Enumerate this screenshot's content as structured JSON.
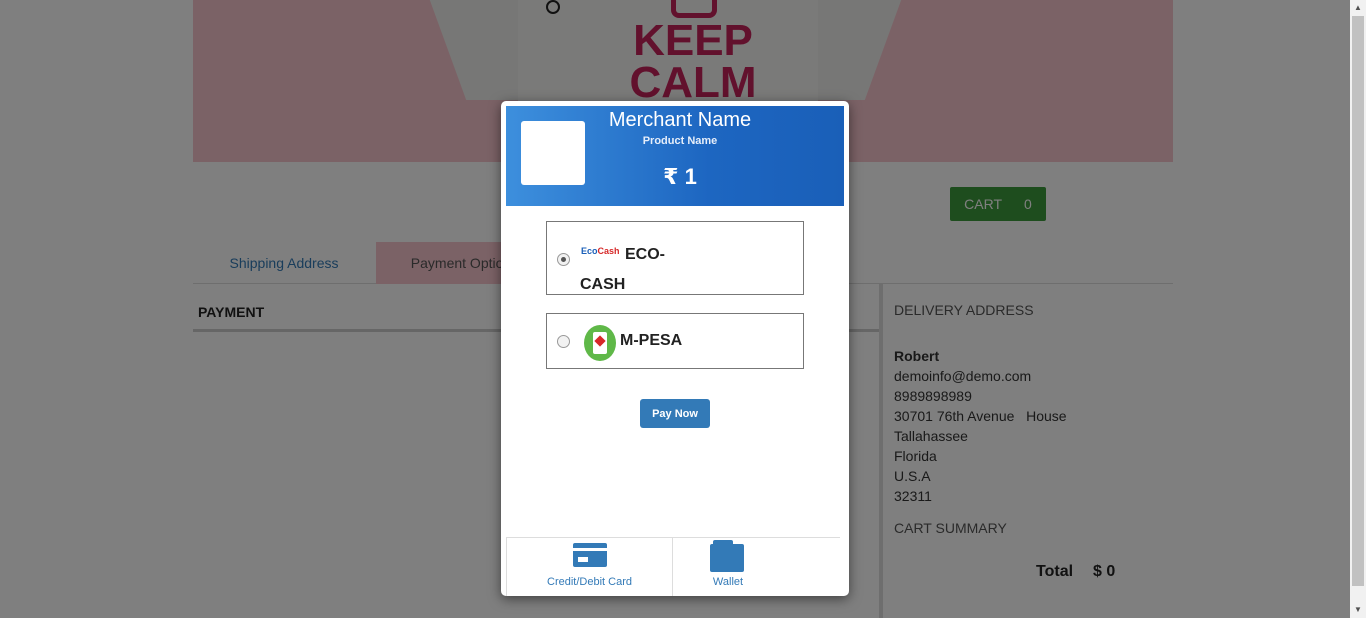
{
  "banner": {
    "slogan": "KEEP\nCALM"
  },
  "cart": {
    "label": "CART",
    "count": "0"
  },
  "tabs": [
    {
      "label": "Shipping Address"
    },
    {
      "label": "Payment Option"
    }
  ],
  "payment": {
    "heading": "PAYMENT"
  },
  "delivery": {
    "heading": "DELIVERY ADDRESS",
    "name": "Robert",
    "email": "demoinfo@demo.com",
    "phone": "8989898989",
    "street": "30701 76th Avenue   House",
    "city": "Tallahassee",
    "state": "Florida",
    "country": "U.S.A",
    "zip": "32311"
  },
  "summary": {
    "heading": "CART SUMMARY",
    "total_label": "Total",
    "total_value": "$ 0"
  },
  "modal": {
    "merchant_name": "Merchant Name",
    "product_name": "Product Name",
    "amount": "₹ 1",
    "options": [
      {
        "logo_part1": "Eco",
        "logo_part2": "Cash",
        "label": "ECO-CASH",
        "selected": true
      },
      {
        "label": "M-PESA",
        "selected": false
      }
    ],
    "pay_button": "Pay Now",
    "bottom_tabs": [
      {
        "label": "Credit/Debit Card",
        "icon": "credit-card-icon"
      },
      {
        "label": "Wallet",
        "icon": "wallet-icon"
      }
    ]
  },
  "colors": {
    "header_gradient_start": "#3d8fdd",
    "header_gradient_end": "#1a5fb8",
    "primary": "#337ab7",
    "cart_green": "#3c9a3c",
    "banner_pink": "#f7c4cc",
    "slogan": "#c4235a"
  }
}
